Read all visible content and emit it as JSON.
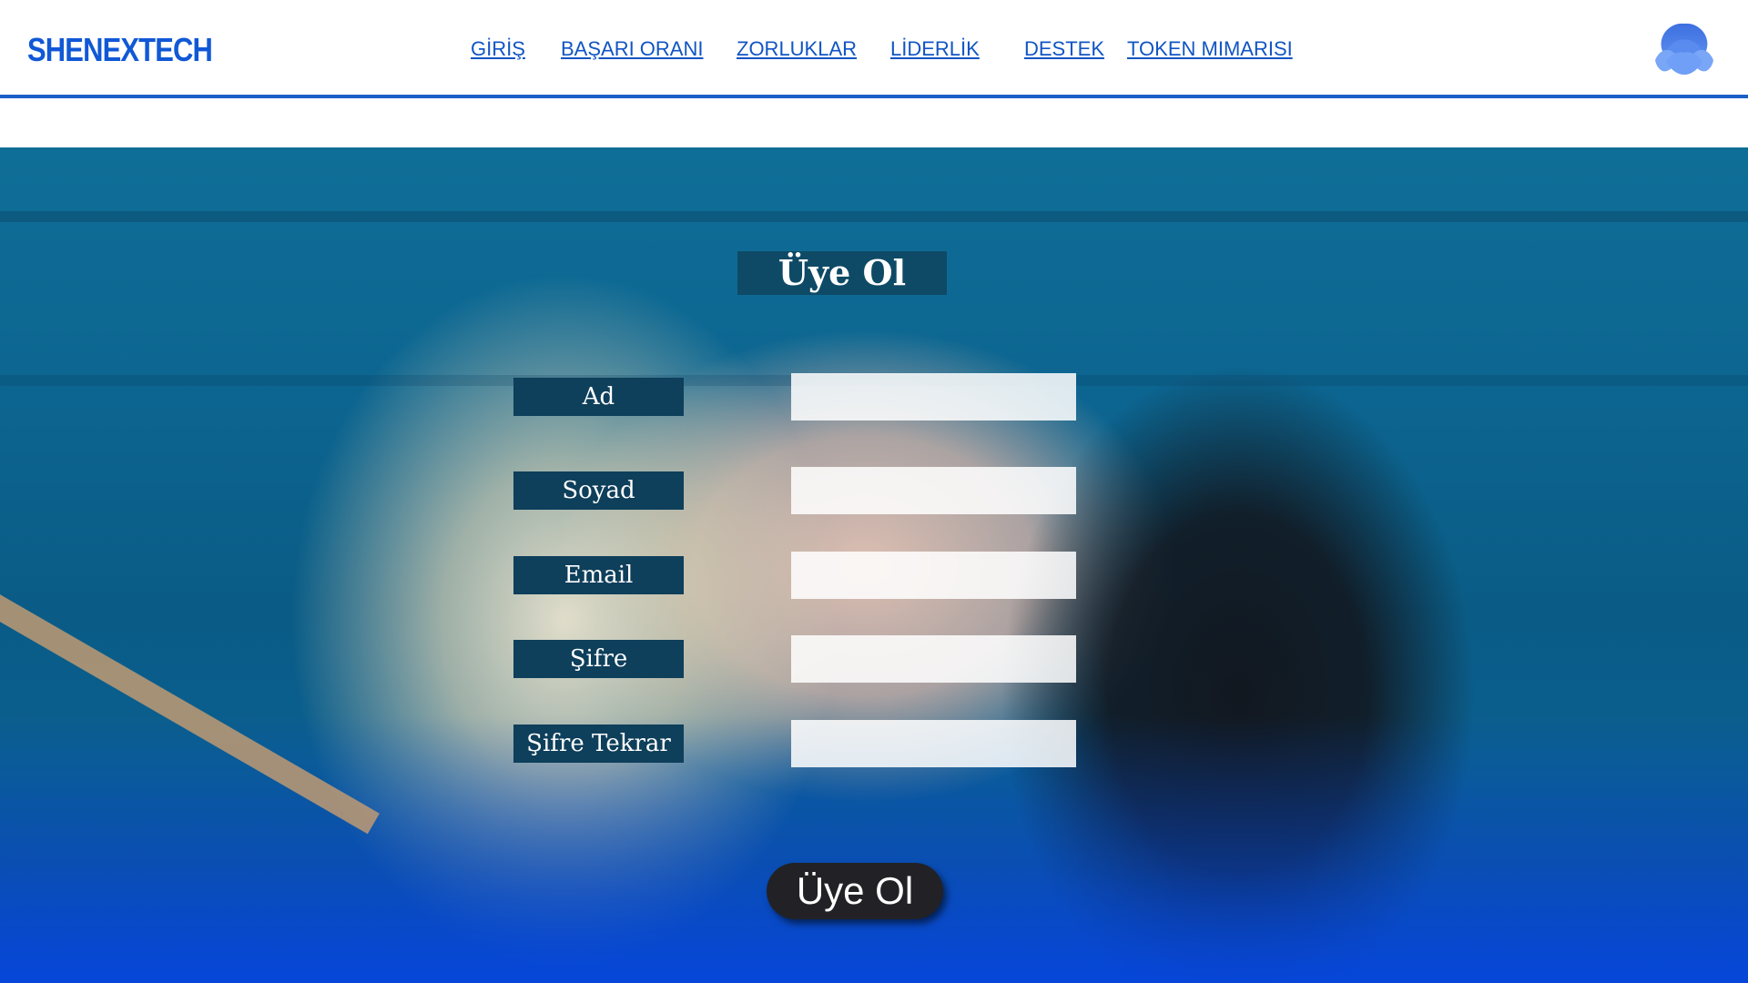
{
  "header": {
    "logo": "SHENEXTECH",
    "nav": [
      {
        "label": "GİRİŞ"
      },
      {
        "label": "BAŞARI ORANI"
      },
      {
        "label": "ZORLUKLAR"
      },
      {
        "label": "LİDERLİK"
      },
      {
        "label": "DESTEK"
      },
      {
        "label": "TOKEN MIMARISI"
      }
    ],
    "avatar_icon": "shell-avatar-icon",
    "accent_color": "#1a5fc8"
  },
  "form": {
    "title": "Üye Ol",
    "fields": [
      {
        "label": "Ad",
        "value": ""
      },
      {
        "label": "Soyad",
        "value": ""
      },
      {
        "label": "Email",
        "value": ""
      },
      {
        "label": "Şifre",
        "value": ""
      },
      {
        "label": "Şifre Tekrar",
        "value": ""
      }
    ],
    "submit_label": "Üye Ol"
  }
}
